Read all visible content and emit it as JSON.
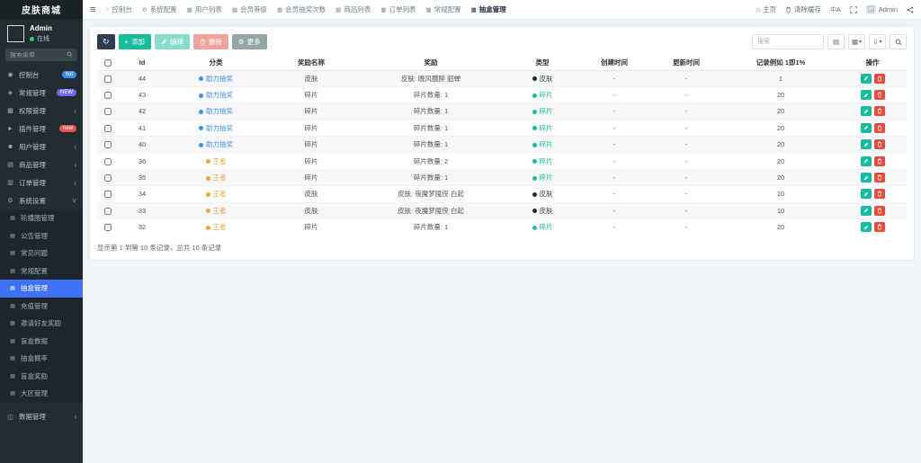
{
  "app": {
    "title": "皮肤商城"
  },
  "colors": {
    "blue": "#3d8ef5",
    "orange": "#f0a63a",
    "green": "#18bc9c",
    "dark": "#1f2d3d",
    "red": "#e74c3c",
    "badge_blue": "#3e8ef7",
    "badge_purple": "#7367f0",
    "badge_red": "#ea5455"
  },
  "sidebar": {
    "user": {
      "name": "Admin",
      "status": "在线"
    },
    "search_placeholder": "搜索菜单",
    "menu": [
      {
        "label": "控制台",
        "icon": "dashboard-icon",
        "badge": "hot",
        "badge_color": "#3e8ef7"
      },
      {
        "label": "常规管理",
        "icon": "general-icon",
        "badge": "NEW",
        "badge_color": "#7367f0"
      },
      {
        "label": "权限管理",
        "icon": "permission-icon",
        "chevron": true
      },
      {
        "label": "插件管理",
        "icon": "plugin-icon",
        "badge": "new",
        "badge_color": "#ea5455"
      },
      {
        "label": "用户管理",
        "icon": "user-icon",
        "chevron": true
      },
      {
        "label": "商品管理",
        "icon": "product-icon",
        "chevron": true
      },
      {
        "label": "订单管理",
        "icon": "order-icon",
        "chevron": true
      },
      {
        "label": "系统设置",
        "icon": "settings-icon",
        "chevron": true,
        "expanded": true,
        "children": [
          {
            "label": "轮播图管理"
          },
          {
            "label": "公告管理"
          },
          {
            "label": "常见问题"
          },
          {
            "label": "常规配置"
          },
          {
            "label": "抽盒管理",
            "active": true
          },
          {
            "label": "充值管理"
          },
          {
            "label": "邀请好友奖励"
          },
          {
            "label": "盲盒数据"
          },
          {
            "label": "抽盒概率"
          },
          {
            "label": "盲盒奖励"
          },
          {
            "label": "大区管理"
          }
        ]
      },
      {
        "label": "数据管理",
        "icon": "database-icon",
        "chevron": true,
        "gap_before": true
      }
    ]
  },
  "topbar": {
    "tabs": [
      {
        "label": "控制台",
        "icon": "home-icon"
      },
      {
        "label": "系统配置",
        "icon": "gear-icon"
      },
      {
        "label": "用户列表",
        "icon": "table-icon"
      },
      {
        "label": "会员等级",
        "icon": "table-icon"
      },
      {
        "label": "会员抽奖次数",
        "icon": "table-icon"
      },
      {
        "label": "商品列表",
        "icon": "table-icon"
      },
      {
        "label": "订单列表",
        "icon": "table-icon"
      },
      {
        "label": "常规配置",
        "icon": "table-icon"
      },
      {
        "label": "抽盒管理",
        "icon": "table-icon",
        "active": true
      }
    ],
    "right": {
      "home": "主页",
      "clear_cache": "清除缓存",
      "user": "Admin"
    }
  },
  "toolbar": {
    "add": "添加",
    "edit": "编辑",
    "delete": "删除",
    "more": "更多",
    "search_placeholder": "搜索"
  },
  "table": {
    "columns": [
      "Id",
      "分类",
      "奖励名称",
      "奖励",
      "类型",
      "创建时间",
      "更新时间",
      "记录例如 1即1%",
      "操作"
    ],
    "rows": [
      {
        "id": "44",
        "category": "助力抽奖",
        "category_color": "blue",
        "name": "皮肤",
        "reward": "皮肤: 晚风醺醉 貂蝉",
        "type": "皮肤",
        "type_color": "dark",
        "created": "-",
        "updated": "-",
        "ratio": "1"
      },
      {
        "id": "43",
        "category": "助力抽奖",
        "category_color": "blue",
        "name": "碎片",
        "reward": "碎片数量: 1",
        "type": "碎片",
        "type_color": "green",
        "created": "-",
        "updated": "-",
        "ratio": "20"
      },
      {
        "id": "42",
        "category": "助力抽奖",
        "category_color": "blue",
        "name": "碎片",
        "reward": "碎片数量: 1",
        "type": "碎片",
        "type_color": "green",
        "created": "-",
        "updated": "-",
        "ratio": "20"
      },
      {
        "id": "41",
        "category": "助力抽奖",
        "category_color": "blue",
        "name": "碎片",
        "reward": "碎片数量: 1",
        "type": "碎片",
        "type_color": "green",
        "created": "-",
        "updated": "-",
        "ratio": "20"
      },
      {
        "id": "40",
        "category": "助力抽奖",
        "category_color": "blue",
        "name": "碎片",
        "reward": "碎片数量: 1",
        "type": "碎片",
        "type_color": "green",
        "created": "-",
        "updated": "-",
        "ratio": "20"
      },
      {
        "id": "36",
        "category": "王者",
        "category_color": "orange",
        "name": "碎片",
        "reward": "碎片数量: 2",
        "type": "碎片",
        "type_color": "green",
        "created": "-",
        "updated": "-",
        "ratio": "20"
      },
      {
        "id": "35",
        "category": "王者",
        "category_color": "orange",
        "name": "碎片",
        "reward": "碎片数量: 1",
        "type": "碎片",
        "type_color": "green",
        "created": "-",
        "updated": "-",
        "ratio": "20"
      },
      {
        "id": "34",
        "category": "王者",
        "category_color": "orange",
        "name": "皮肤",
        "reward": "皮肤: 夜魔梦魇侠 白起",
        "type": "皮肤",
        "type_color": "dark",
        "created": "-",
        "updated": "-",
        "ratio": "10"
      },
      {
        "id": "33",
        "category": "王者",
        "category_color": "orange",
        "name": "皮肤",
        "reward": "皮肤: 夜魔梦魇侠 白起",
        "type": "皮肤",
        "type_color": "dark",
        "created": "-",
        "updated": "-",
        "ratio": "10"
      },
      {
        "id": "32",
        "category": "王者",
        "category_color": "orange",
        "name": "碎片",
        "reward": "碎片数量: 1",
        "type": "碎片",
        "type_color": "green",
        "created": "-",
        "updated": "-",
        "ratio": "20"
      }
    ],
    "footer": "显示第 1 到第 10 条记录，总共 10 条记录"
  }
}
